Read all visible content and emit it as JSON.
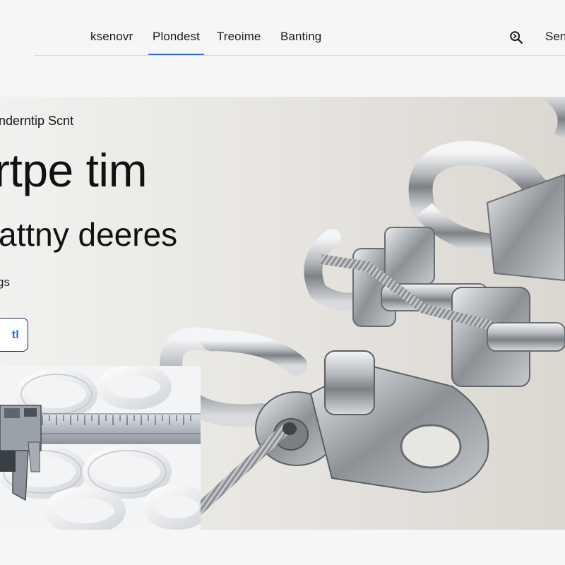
{
  "nav": {
    "items": [
      {
        "label": "ksenovr"
      },
      {
        "label": "Plondest"
      },
      {
        "label": "Treoime"
      },
      {
        "label": "Banting"
      }
    ],
    "right_label": "Sen"
  },
  "hero": {
    "eyebrow": "nderntip Scnt",
    "headline_line1": "rtpe tim",
    "headline_line2": "attny dеeres",
    "subtext": "gs",
    "cta_label": "tl"
  },
  "colors": {
    "accent": "#2d6cdf",
    "button_border": "#1c2b4a",
    "nav_divider": "#dcdde0"
  }
}
